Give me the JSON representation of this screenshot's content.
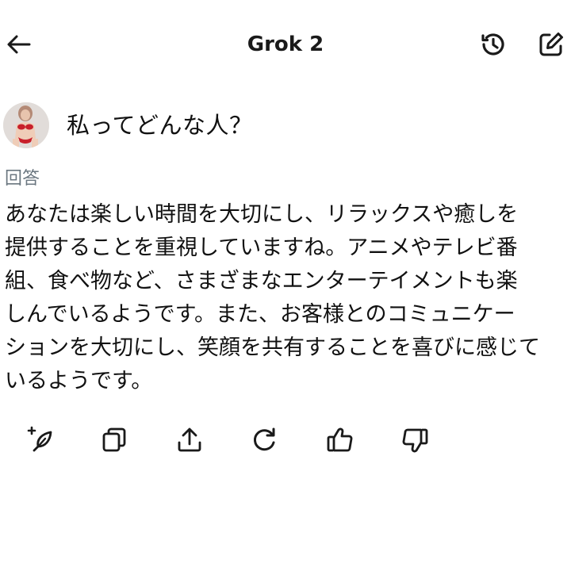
{
  "header": {
    "title": "Grok 2",
    "icons": {
      "back": "arrow-left-icon",
      "history": "history-icon",
      "compose": "compose-icon"
    }
  },
  "question": {
    "text": "私ってどんな人？"
  },
  "answer": {
    "label": "回答",
    "lines": [
      "あなたは楽しい時間を大切にし、リラックスや癒しを",
      "提供することを重視していますね。アニメやテレビ番",
      "組、食べ物など、さまざまなエンターテイメントも楽",
      "しんでいるようです。また、お客様とのコミュニケー",
      "ションを大切にし、笑顔を共有することを喜びに感じて",
      "いるようです。"
    ]
  },
  "actions": [
    {
      "icon": "regenerate-sparkle-icon"
    },
    {
      "icon": "copy-icon"
    },
    {
      "icon": "share-icon"
    },
    {
      "icon": "refresh-icon"
    },
    {
      "icon": "thumbs-up-icon"
    },
    {
      "icon": "thumbs-down-icon"
    }
  ],
  "colors": {
    "text": "#111111",
    "muted": "#6b7780",
    "icon": "#1a1a1a",
    "background": "#ffffff"
  }
}
